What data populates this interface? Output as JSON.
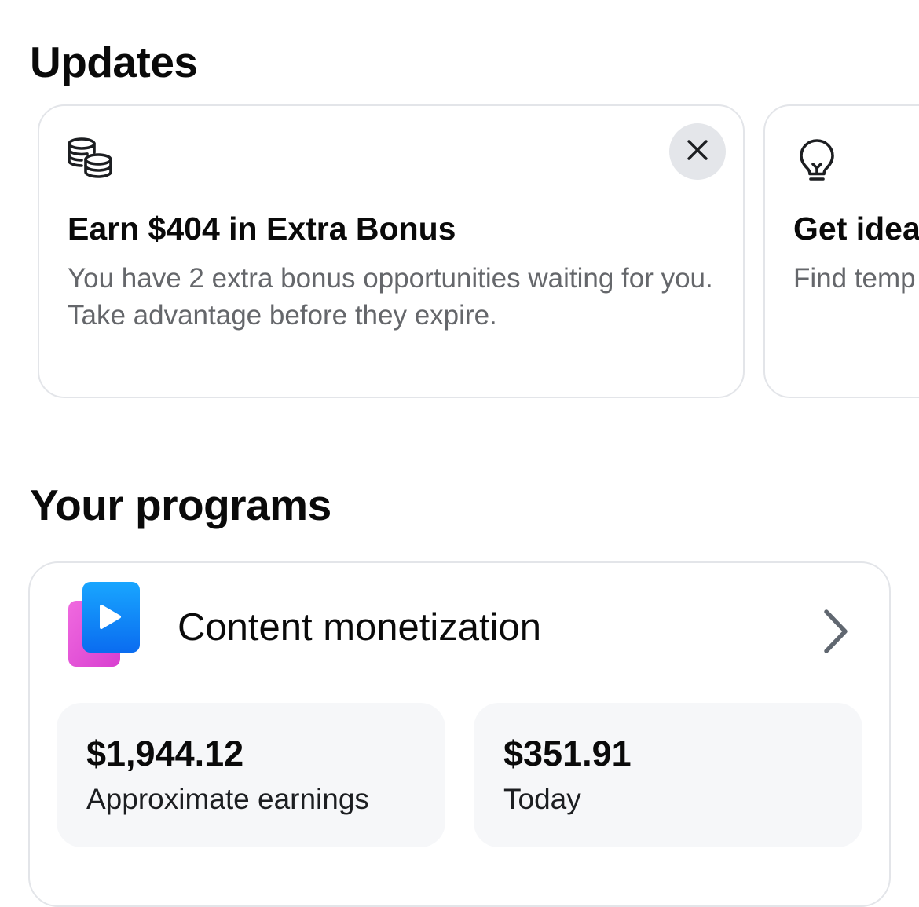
{
  "updates": {
    "title": "Updates",
    "cards": [
      {
        "icon": "coins-stack-icon",
        "heading": "Earn $404 in Extra Bonus",
        "body": "You have 2 extra bonus opportunities waiting for you. Take advantage before they expire."
      },
      {
        "icon": "lightbulb-icon",
        "heading": "Get idea",
        "body": "Find temp to inspire"
      }
    ]
  },
  "programs": {
    "title": "Your programs",
    "items": [
      {
        "icon": "content-monetization-icon",
        "name": "Content monetization",
        "stats": [
          {
            "value": "$1,944.12",
            "label": "Approximate earnings"
          },
          {
            "value": "$351.91",
            "label": "Today"
          }
        ]
      }
    ]
  },
  "colors": {
    "card_border": "#e3e5e9",
    "close_button_bg": "#e4e6ea",
    "secondary_text": "#65676b",
    "stat_bg": "#f6f7f9",
    "chevron": "#606770",
    "icon_blue": "#1877f2",
    "icon_pink": "#e84fd1"
  }
}
